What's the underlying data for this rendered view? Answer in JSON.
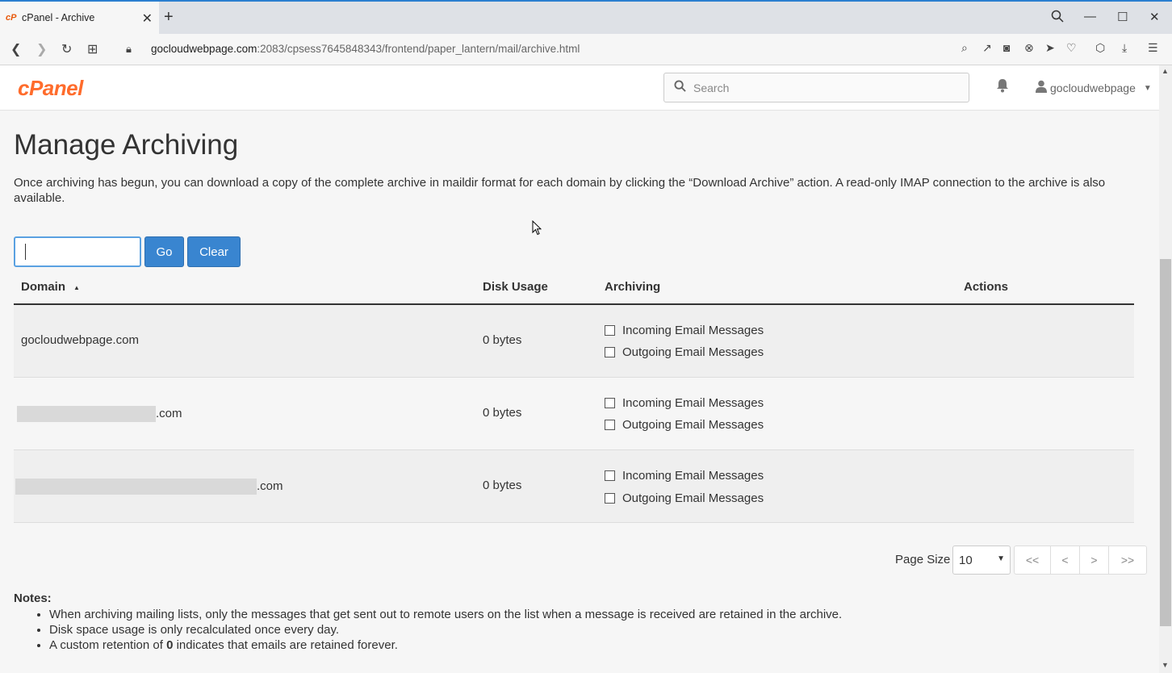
{
  "browser": {
    "tab_title": "cPanel - Archive",
    "favicon_text": "cP",
    "url_host": "gocloudwebpage.com",
    "url_rest": ":2083/cpsess7645848343/frontend/paper_lantern/mail/archive.html"
  },
  "header": {
    "logo": "cPanel",
    "search_placeholder": "Search",
    "username": "gocloudwebpage"
  },
  "page": {
    "title": "Manage Archiving",
    "description": "Once archiving has begun, you can download a copy of the complete archive in maildir format for each domain by clicking the “Download Archive” action. A read-only IMAP connection to the archive is also available.",
    "go_label": "Go",
    "clear_label": "Clear"
  },
  "table": {
    "columns": [
      "Domain",
      "Disk Usage",
      "Archiving",
      "Actions"
    ],
    "rows": [
      {
        "domain": "gocloudwebpage.com",
        "domain_suffix": "",
        "disk": "0 bytes",
        "incoming": "Incoming Email Messages",
        "outgoing": "Outgoing Email Messages",
        "incoming_checked": false,
        "outgoing_checked": false
      },
      {
        "domain": "",
        "domain_suffix": ".com",
        "disk": "0 bytes",
        "incoming": "Incoming Email Messages",
        "outgoing": "Outgoing Email Messages",
        "incoming_checked": false,
        "outgoing_checked": false
      },
      {
        "domain": "",
        "domain_suffix": ".com",
        "disk": "0 bytes",
        "incoming": "Incoming Email Messages",
        "outgoing": "Outgoing Email Messages",
        "incoming_checked": false,
        "outgoing_checked": false
      }
    ]
  },
  "pagination": {
    "page_size_label": "Page Size",
    "page_size": "10",
    "first": "<<",
    "prev": "<",
    "next": ">",
    "last": ">>"
  },
  "notes": {
    "title": "Notes:",
    "items": [
      "When archiving mailing lists, only the messages that get sent out to remote users on the list when a message is received are retained in the archive.",
      "Disk space usage is only recalculated once every day.",
      "A custom retention of 0 indicates that emails are retained forever."
    ],
    "item3_prefix": "A custom retention of ",
    "item3_bold": "0",
    "item3_suffix": " indicates that emails are retained forever."
  },
  "colors": {
    "accent": "#3985d0",
    "brand": "#ff6c2c"
  }
}
